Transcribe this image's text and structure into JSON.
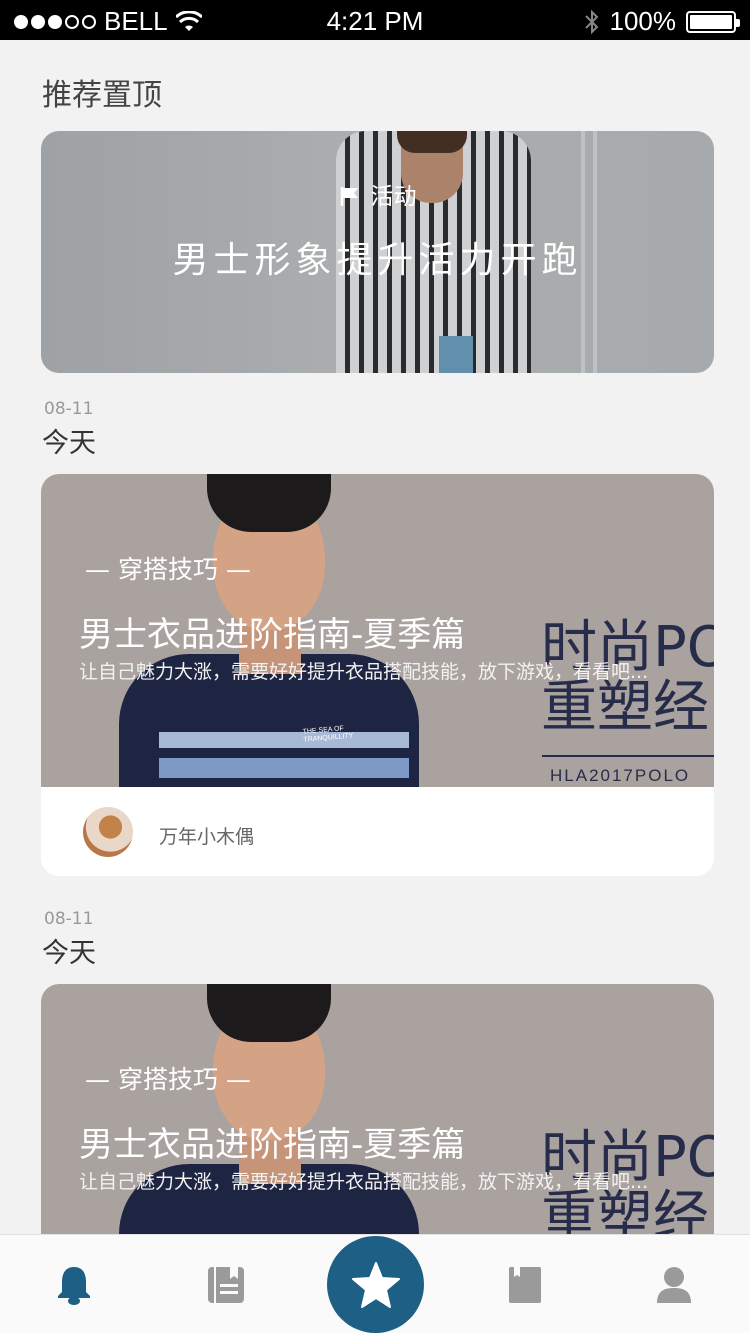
{
  "status_bar": {
    "carrier": "BELL",
    "time": "4:21 PM",
    "battery": "100%"
  },
  "sections": {
    "pinned_title": "推荐置顶"
  },
  "banner": {
    "tag": "活动",
    "headline": "男士形象提升活力开跑"
  },
  "feed": [
    {
      "date": "08-11",
      "day_label": "今天",
      "category": "— 穿搭技巧 —",
      "title": "男士衣品进阶指南-夏季篇",
      "description": "让自己魅力大涨，需要好好提升衣品搭配技能，放下游戏，看看吧...",
      "author": "万年小木偶",
      "ad_text_1": "时尚PO",
      "ad_text_2": "重塑经",
      "ad_code": "HLA2017POLO",
      "shirt_text": "THE SEA OF TRANQUILLITY"
    },
    {
      "date": "08-11",
      "day_label": "今天",
      "category": "— 穿搭技巧 —",
      "title": "男士衣品进阶指南-夏季篇",
      "description": "让自己魅力大涨，需要好好提升衣品搭配技能，放下游戏，看看吧...",
      "ad_text_1": "时尚PO",
      "ad_text_2": "重塑经"
    }
  ],
  "tab_bar": {
    "items": [
      {
        "icon": "bell-icon",
        "active": true
      },
      {
        "icon": "notebook-icon",
        "active": false
      },
      {
        "icon": "star-icon",
        "active": false
      },
      {
        "icon": "bookmark-book-icon",
        "active": false
      },
      {
        "icon": "user-icon",
        "active": false
      }
    ]
  },
  "colors": {
    "accent": "#1d5f85",
    "background": "#f2f2f2",
    "inactive_icon": "#9a9a9a"
  }
}
